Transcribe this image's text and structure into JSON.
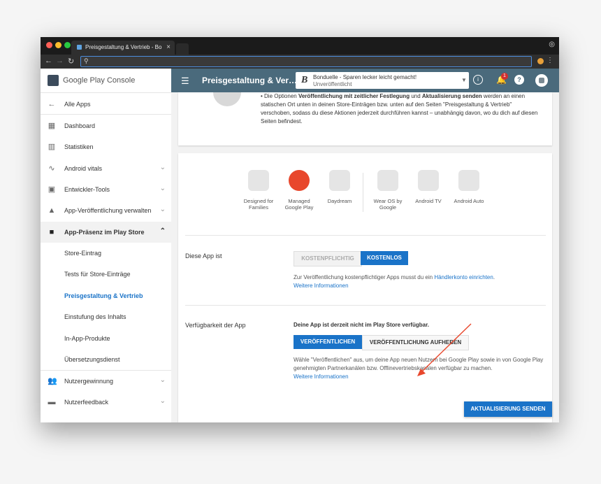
{
  "browser": {
    "tab_title": "Preisgestaltung & Vertrieb - Bo",
    "address_placeholder": "",
    "colors": {
      "red": "#ff5f57",
      "yellow": "#febc2e",
      "green": "#28c840"
    }
  },
  "brand": {
    "name": "Google Play Console"
  },
  "sidebar": {
    "items": [
      {
        "label": "Alle Apps",
        "icon": "arrow-left-icon"
      },
      {
        "label": "Dashboard",
        "icon": "dashboard-icon"
      },
      {
        "label": "Statistiken",
        "icon": "bar-chart-icon"
      },
      {
        "label": "Android vitals",
        "icon": "vitals-icon"
      },
      {
        "label": "Entwickler-Tools",
        "icon": "dev-tools-icon"
      },
      {
        "label": "App-Veröffentlichung verwalten",
        "icon": "rocket-icon"
      },
      {
        "label": "App-Präsenz im Play Store",
        "icon": "store-icon"
      },
      {
        "label": "Store-Eintrag"
      },
      {
        "label": "Tests für Store-Einträge"
      },
      {
        "label": "Preisgestaltung & Vertrieb"
      },
      {
        "label": "Einstufung des Inhalts"
      },
      {
        "label": "In-App-Produkte"
      },
      {
        "label": "Übersetzungsdienst"
      },
      {
        "label": "Nutzergewinnung",
        "icon": "user-acquisition-icon"
      },
      {
        "label": "Nutzerfeedback",
        "icon": "feedback-icon"
      }
    ]
  },
  "header": {
    "title": "Preisgestaltung & Ver…",
    "app_name": "Bonduelle - Sparen lecker leicht gemacht!",
    "app_status": "Unveröffentlicht",
    "notification_count": "1"
  },
  "intro": {
    "text_a": "Die Optionen ",
    "bold_a": "Veröffentlichung mit zeitlicher Festlegung",
    "text_b": " und ",
    "bold_b": "Aktualisierung senden",
    "text_c": " werden an einen statischen Ort unten in deinen Store-Einträgen bzw. unten auf den Seiten \"Preisgestaltung & Vertrieb\" verschoben, sodass du diese Aktionen jederzeit durchführen kannst – unabhängig davon, wo du dich auf diesen Seiten befindest."
  },
  "features": [
    {
      "l1": "Designed for",
      "l2": "Families"
    },
    {
      "l1": "Managed",
      "l2": "Google Play"
    },
    {
      "l1": "Daydream",
      "l2": ""
    },
    {
      "l1": "Wear OS by",
      "l2": "Google"
    },
    {
      "l1": "Android TV",
      "l2": ""
    },
    {
      "l1": "Android Auto",
      "l2": ""
    }
  ],
  "pricing": {
    "label": "Diese App ist",
    "paid": "KOSTENPFLICHTIG",
    "free": "KOSTENLOS",
    "note_text": "Zur Veröffentlichung kostenpflichtiger Apps musst du ein ",
    "note_link": "Händlerkonto einrichten",
    "note_end": ".",
    "more": "Weitere Informationen"
  },
  "availability": {
    "label": "Verfügbarkeit der App",
    "status": "Deine App ist derzeit nicht im Play Store verfügbar.",
    "publish": "VERÖFFENTLICHEN",
    "unpublish": "VERÖFFENTLICHUNG AUFHEBEN",
    "note": "Wähle \"Veröffentlichen\" aus, um deine App neuen Nutzern bei Google Play sowie in von Google Play genehmigten Partnerkanälen bzw. Offlinevertriebskanälen verfügbar zu machen.",
    "more": "Weitere Informationen"
  },
  "submit": {
    "label": "AKTUALISIERUNG SENDEN"
  }
}
